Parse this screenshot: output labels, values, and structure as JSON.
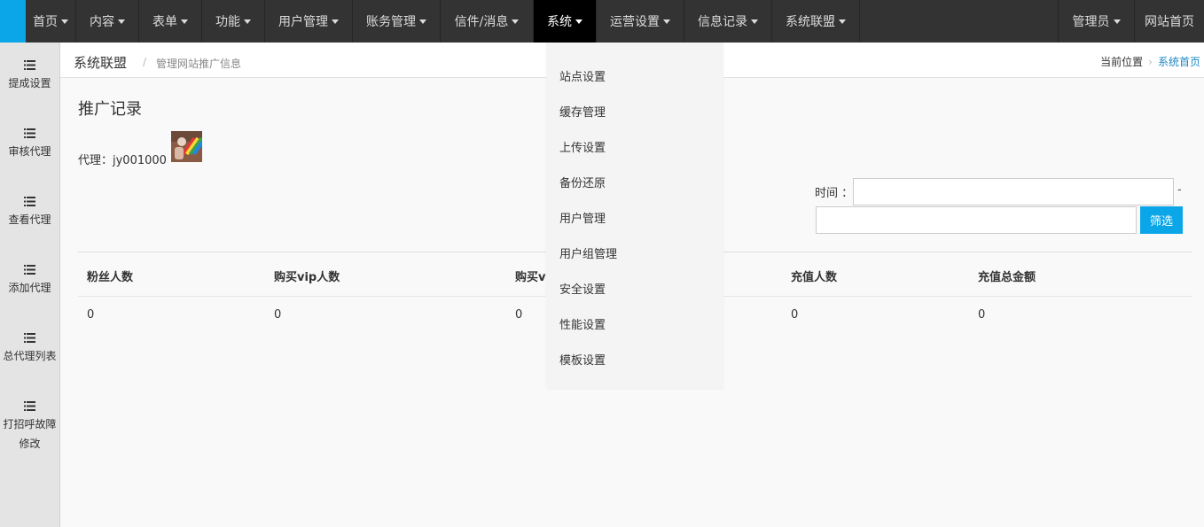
{
  "topnav": {
    "items": [
      {
        "label": "首页"
      },
      {
        "label": "内容"
      },
      {
        "label": "表单"
      },
      {
        "label": "功能"
      },
      {
        "label": "用户管理"
      },
      {
        "label": "账务管理"
      },
      {
        "label": "信件/消息"
      },
      {
        "label": "系统"
      },
      {
        "label": "运营设置"
      },
      {
        "label": "信息记录"
      },
      {
        "label": "系统联盟"
      }
    ],
    "admin_label": "管理员",
    "site_home_label": "网站首页"
  },
  "sidebar": {
    "items": [
      {
        "label": "提成设置"
      },
      {
        "label": "审核代理"
      },
      {
        "label": "查看代理"
      },
      {
        "label": "添加代理"
      },
      {
        "label": "总代理列表"
      },
      {
        "label": "打招呼故障修改"
      }
    ]
  },
  "breadcrumb": {
    "title": "系统联盟",
    "separator": "/",
    "subtitle": "管理网站推广信息",
    "location_label": "当前位置",
    "chevron": "›",
    "home_link": "系统首页"
  },
  "main": {
    "heading": "推广记录",
    "agent_text": "代理：jy001000",
    "filter": {
      "time_label": "时间 ：",
      "start_value": "",
      "dash": "-",
      "end_value": "",
      "filter_button": "筛选"
    },
    "table": {
      "headers": [
        "粉丝人数",
        "购买vip人数",
        "购买v",
        "充值人数",
        "充值总金额"
      ],
      "rows": [
        [
          "0",
          "0",
          "0",
          "0",
          "0"
        ]
      ]
    }
  },
  "dropdown": {
    "items": [
      {
        "label": "站点设置"
      },
      {
        "label": "缓存管理"
      },
      {
        "label": "上传设置"
      },
      {
        "label": "备份还原"
      },
      {
        "label": "用户管理"
      },
      {
        "label": "用户组管理"
      },
      {
        "label": "安全设置"
      },
      {
        "label": "性能设置"
      },
      {
        "label": "模板设置"
      }
    ]
  },
  "colors": {
    "topbar_bg": "#333333",
    "accent": "#0aa6e8",
    "active_nav": "#000000",
    "link": "#1e88c7"
  }
}
